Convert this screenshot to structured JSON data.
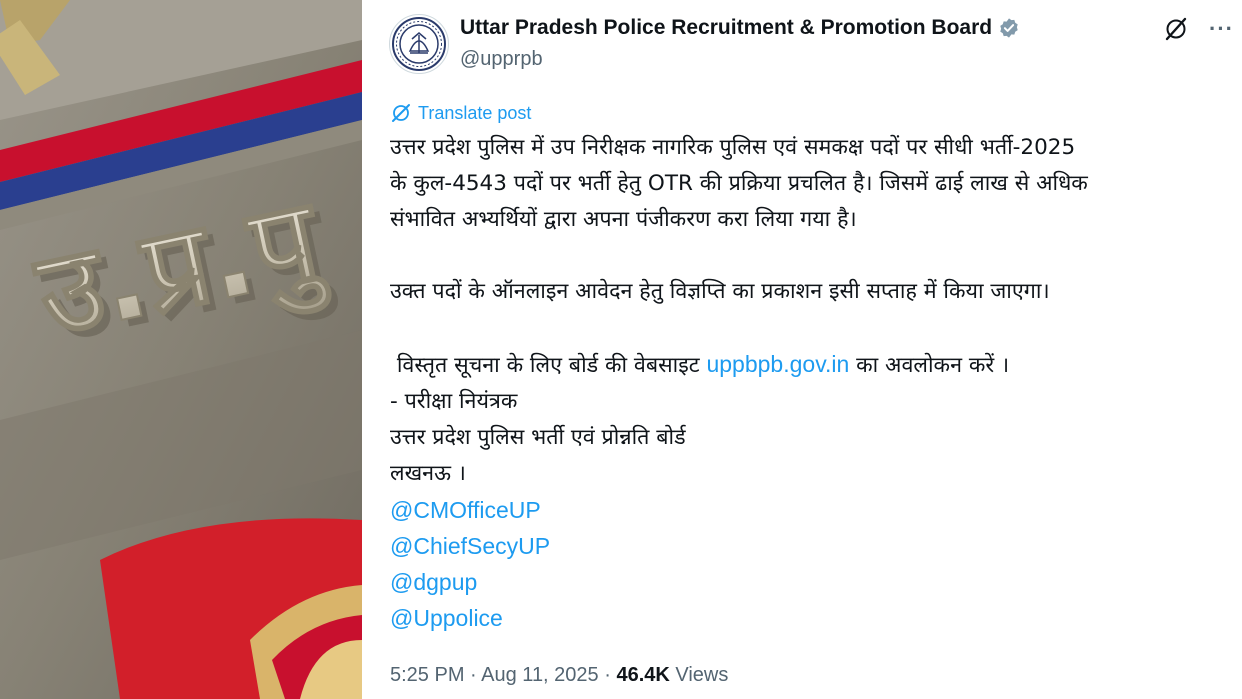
{
  "photo": {
    "badge_text": "उ.प्र.पु"
  },
  "account": {
    "name": "Uttar Pradesh Police Recruitment & Promotion Board",
    "handle": "@upprpb"
  },
  "translate_label": "Translate post",
  "body": {
    "para1": [
      "उत्तर प्रदेश पुलिस में उप निरीक्षक नागरिक पुलिस एवं समकक्ष पदों पर सीधी भर्ती-2025",
      "के कुल-4543 पदों पर भर्ती हेतु OTR की प्रक्रिया प्रचलित है। जिसमें ढाई लाख से अधिक",
      "संभावित अभ्यर्थियों द्वारा अपना पंजीकरण करा लिया गया है।"
    ],
    "para2": "उक्त पदों के ऑनलाइन आवेदन हेतु विज्ञप्ति का प्रकाशन इसी सप्ताह में किया जाएगा।",
    "para3_before": " विस्तृत सूचना के लिए बोर्ड की वेबसाइट ",
    "para3_link": "uppbpb.gov.in",
    "para3_after": " का अवलोकन करें ।",
    "signature": [
      "- परीक्षा नियंत्रक",
      "उत्तर प्रदेश पुलिस भर्ती एवं प्रोन्नति बोर्ड",
      "लखनऊ ।"
    ],
    "mentions": [
      "@CMOfficeUP",
      "@ChiefSecyUP",
      "@dgpup",
      "@Uppolice"
    ]
  },
  "meta": {
    "time": "5:25 PM",
    "sep": " · ",
    "date": "Aug 11, 2025",
    "views_count": "46.4K",
    "views_label": " Views"
  },
  "colors": {
    "link": "#1d9bf0",
    "secondary": "#536471",
    "verified": "#829aab",
    "badge_red": "#c8102e",
    "badge_blue": "#2a3f8f"
  },
  "icons": [
    "verified-badge-icon",
    "grok-icon",
    "more-icon",
    "translate-icon"
  ]
}
